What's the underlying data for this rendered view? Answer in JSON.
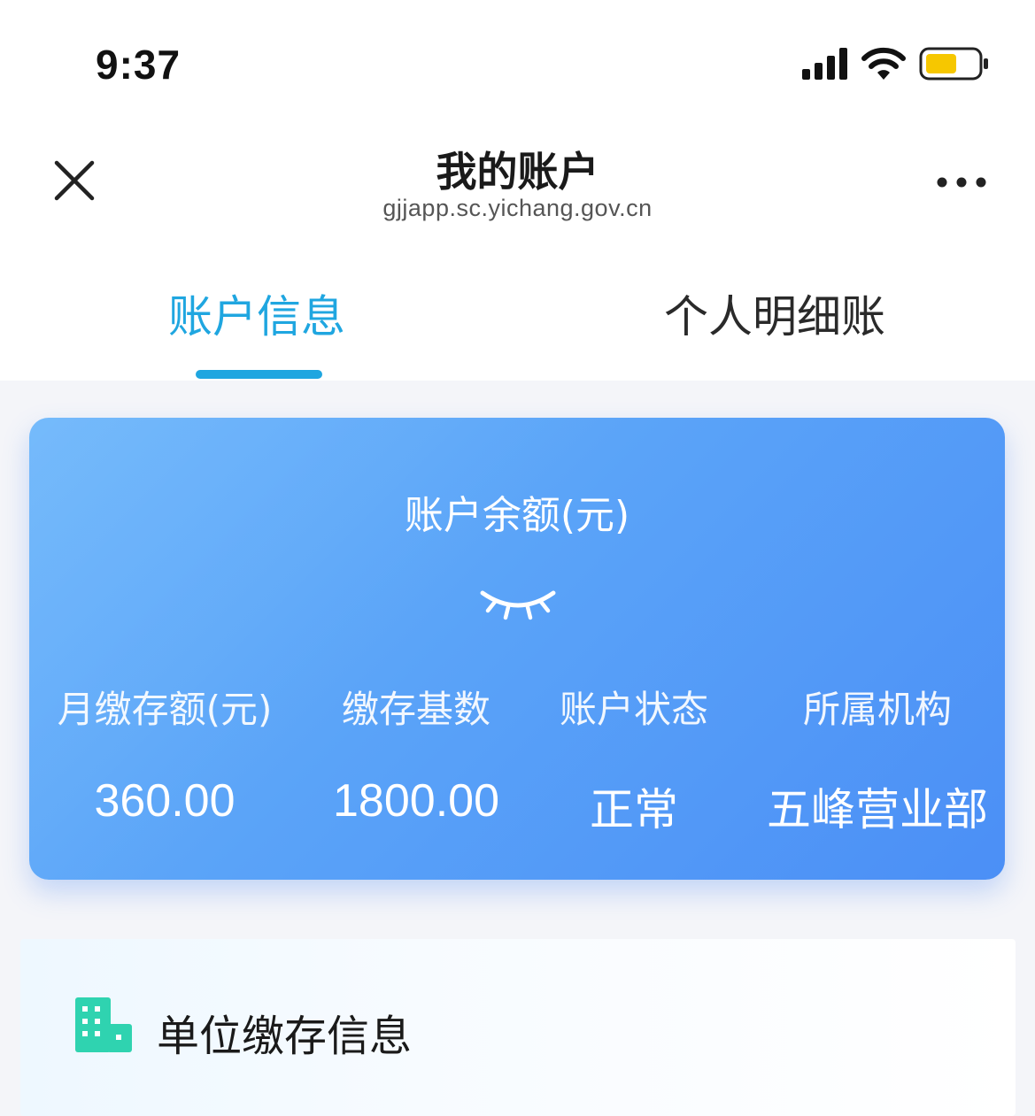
{
  "status_bar": {
    "time": "9:37",
    "battery_color": "#f6c700",
    "icons": [
      "signal-icon",
      "wifi-icon",
      "battery-icon"
    ]
  },
  "nav": {
    "title": "我的账户",
    "subtitle": "gjjapp.sc.yichang.gov.cn",
    "close_icon": "close-icon",
    "more_icon": "more-icon"
  },
  "tabs": [
    {
      "label": "账户信息",
      "active": true
    },
    {
      "label": "个人明细账",
      "active": false
    }
  ],
  "colors": {
    "accent": "#1fa6e0",
    "card_gradient_start": "#6cb6fb",
    "card_gradient_end": "#4b8ff6",
    "section_icon": "#2fd3b0"
  },
  "balance_card": {
    "balance_label": "账户余额(元)",
    "visibility_icon": "eye-closed-icon",
    "stats": [
      {
        "label": "月缴存额(元)",
        "value": "360.00"
      },
      {
        "label": "缴存基数",
        "value": "1800.00"
      },
      {
        "label": "账户状态",
        "value": "正常"
      },
      {
        "label": "所属机构",
        "value": "五峰营业部"
      }
    ]
  },
  "sections": [
    {
      "title": "单位缴存信息",
      "icon": "building-icon"
    }
  ]
}
